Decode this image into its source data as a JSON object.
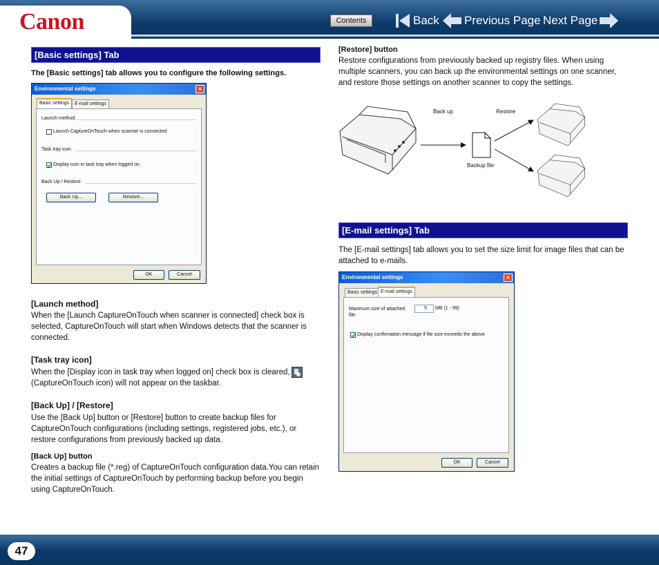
{
  "header": {
    "logo": "Canon",
    "contents_label": "Contents",
    "back_label": "Back",
    "previous_label": "Previous Page",
    "next_label": "Next Page"
  },
  "basic": {
    "section_title": "[Basic settings] Tab",
    "intro": "The [Basic settings] tab allows you to configure the following settings.",
    "dialog": {
      "title": "Environmental settings",
      "tab_basic": "Basic settings",
      "tab_email": "E-mail settings",
      "group_launch": "Launch method",
      "launch_checkbox": "Launch CaptureOnTouch when scanner is connected",
      "group_tray": "Task tray icon",
      "tray_checkbox": "Display icon in task tray when logged on",
      "group_backup": "Back Up / Restore",
      "backup_button": "Back Up...",
      "restore_button": "Restore...",
      "ok_button": "OK",
      "cancel_button": "Cancel"
    },
    "launch_heading": "[Launch method]",
    "launch_text": "When the [Launch CaptureOnTouch when scanner is connected] check box is selected, CaptureOnTouch will start when Windows detects that the scanner is connected.",
    "tray_heading": "[Task tray icon]",
    "tray_text_a": "When the [Display icon in task tray when logged on] check box is cleared,",
    "tray_text_b": "(CaptureOnTouch icon) will not appear on the taskbar.",
    "backup_heading": "[Back Up] / [Restore]",
    "backup_text": "Use the [Back Up] button or [Restore] button to create backup files for CaptureOnTouch configurations (including settings, registered jobs, etc.), or restore configurations from previously backed up data.",
    "backup_btn_heading": "[Back Up] button",
    "backup_btn_text": "Creates a backup file (*.reg) of CaptureOnTouch configuration data.You can retain the initial settings of CaptureOnTouch by performing backup before you begin using CaptureOnTouch."
  },
  "restore": {
    "heading": "[Restore] button",
    "text": "Restore configurations from previously backed up registry files. When using multiple scanners, you can back up the environmental settings on one scanner, and restore those settings on another scanner to copy the settings.",
    "diagram": {
      "backup_label": "Back up",
      "restore_label": "Restore",
      "file_label": "Backup file"
    }
  },
  "email": {
    "section_title": "[E-mail settings] Tab",
    "intro": "The [E-mail settings] tab allows you to set the size limit for image files that can be attached to e-mails.",
    "dialog": {
      "title": "Environmental settings",
      "tab_basic": "Basic settings",
      "tab_email": "E-mail settings",
      "max_size_label": "Maximum size of attached file:",
      "max_size_value": "5",
      "max_size_unit": "MB (1 - 99)",
      "confirm_checkbox": "Display confirmation message if file size exceeds the above",
      "ok_button": "OK",
      "cancel_button": "Cancel"
    }
  },
  "footer": {
    "page_number": "47"
  }
}
